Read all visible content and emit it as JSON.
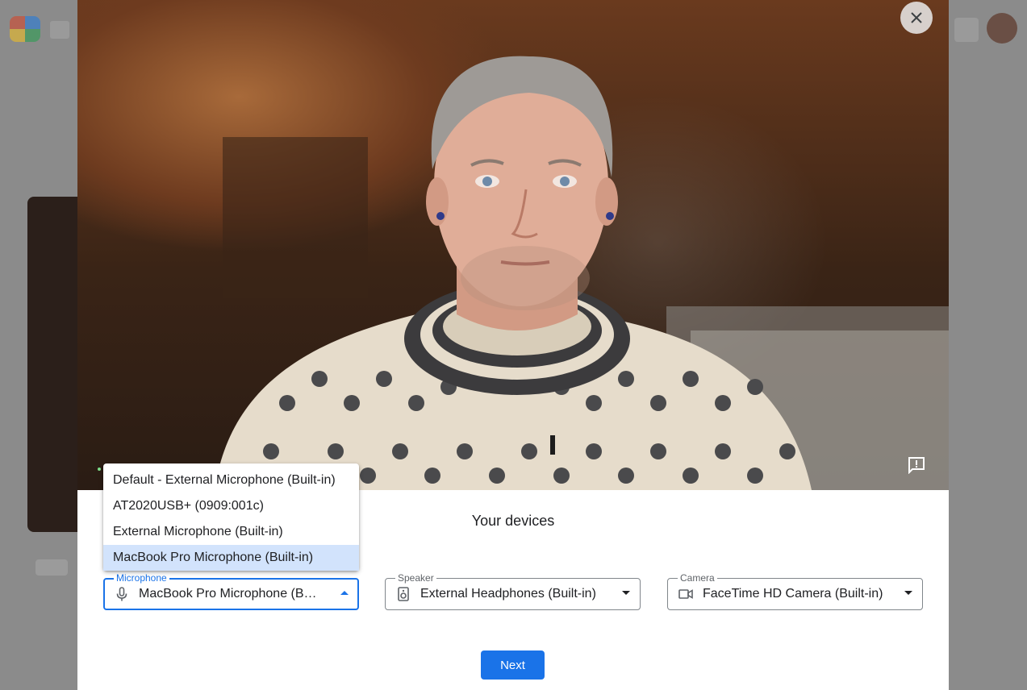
{
  "dialog": {
    "title": "Your devices",
    "next_label": "Next",
    "close_icon": "close-icon",
    "feedback_icon": "feedback-icon"
  },
  "microphone": {
    "label": "Microphone",
    "value": "MacBook Pro Microphone (Built-in)",
    "icon": "microphone-icon",
    "open": true,
    "options": [
      "Default - External Microphone (Built-in)",
      "AT2020USB+ (0909:001c)",
      "External Microphone (Built-in)",
      "MacBook Pro Microphone (Built-in)"
    ],
    "selected_index": 3
  },
  "speaker": {
    "label": "Speaker",
    "value": "External Headphones (Built-in)",
    "icon": "speaker-icon"
  },
  "camera": {
    "label": "Camera",
    "value": "FaceTime HD Camera (Built-in)",
    "icon": "videocam-icon"
  },
  "colors": {
    "accent": "#1a73e8",
    "selected_option_bg": "#d2e3fc"
  }
}
